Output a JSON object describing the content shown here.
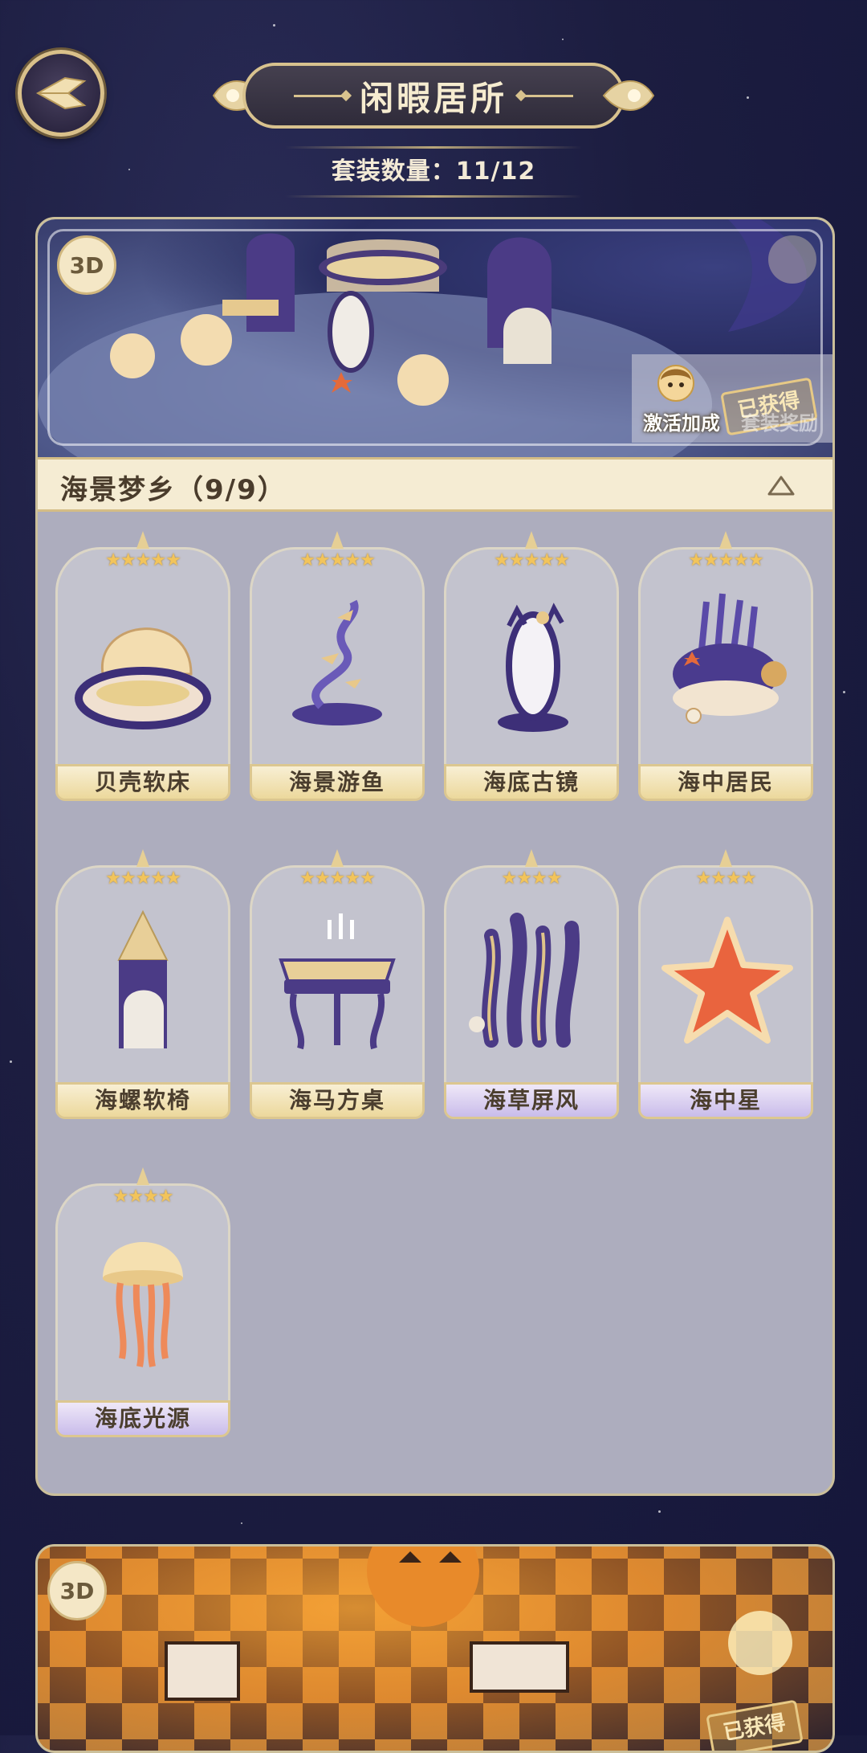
{
  "header": {
    "title": "闲暇居所",
    "suit_count": "套装数量：11/12"
  },
  "section": {
    "badge": "3D",
    "name": "海景梦乡（9/9）",
    "bonus_label": "激活加成",
    "stamp": "已获得",
    "reward_label": "套装奖励",
    "items": [
      {
        "name": "贝壳软床",
        "stars": "★★★★★",
        "rarity": "gold"
      },
      {
        "name": "海景游鱼",
        "stars": "★★★★★",
        "rarity": "gold"
      },
      {
        "name": "海底古镜",
        "stars": "★★★★★",
        "rarity": "gold"
      },
      {
        "name": "海中居民",
        "stars": "★★★★★",
        "rarity": "gold"
      },
      {
        "name": "海螺软椅",
        "stars": "★★★★★",
        "rarity": "gold"
      },
      {
        "name": "海马方桌",
        "stars": "★★★★★",
        "rarity": "gold"
      },
      {
        "name": "海草屏风",
        "stars": "★★★★",
        "rarity": "purple"
      },
      {
        "name": "海中星",
        "stars": "★★★★",
        "rarity": "purple"
      },
      {
        "name": "海底光源",
        "stars": "★★★★",
        "rarity": "purple"
      }
    ]
  },
  "section2": {
    "badge": "3D",
    "stamp": "已获得"
  },
  "colors": {
    "background": "#1c1d40",
    "gold": "#d8c28e",
    "panel": "#adadbe"
  }
}
